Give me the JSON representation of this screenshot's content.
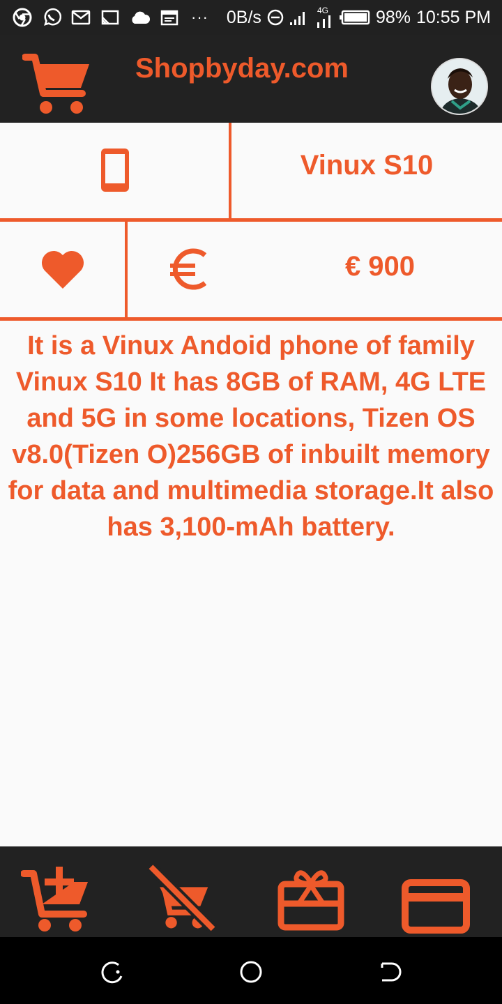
{
  "status_bar": {
    "network_speed": "0B/s",
    "network_type": "4G",
    "battery": "98%",
    "time": "10:55 PM",
    "overflow": "···",
    "icons": [
      "chrome-icon",
      "whatsapp-icon",
      "gmail-icon",
      "cast-icon",
      "cloud-icon",
      "calendar-icon",
      "dnd-icon",
      "signal-icon",
      "battery-icon"
    ]
  },
  "app_bar": {
    "title": "Shopbyday.com",
    "logo_icon": "shopping-cart-icon",
    "avatar": "user-avatar"
  },
  "product": {
    "category_icon": "smartphone-icon",
    "name": "Vinux S10",
    "favorite_icon": "heart-icon",
    "currency_icon": "euro-icon",
    "price": "€ 900",
    "description": "It is a Vinux Andoid phone of family Vinux S10 It has 8GB of RAM, 4G LTE and 5G in some locations, Tizen OS v8.0(Tizen O)256GB of inbuilt memory for data and multimedia storage.It also has 3,100-mAh battery."
  },
  "bottom_bar": {
    "items": [
      {
        "icon": "add-to-cart-icon"
      },
      {
        "icon": "remove-from-cart-icon"
      },
      {
        "icon": "gift-card-icon"
      },
      {
        "icon": "credit-card-icon"
      }
    ]
  },
  "nav_bar": {
    "buttons": [
      "recent-apps",
      "home",
      "back"
    ]
  },
  "colors": {
    "accent": "#ee5a2b",
    "bar_background": "#222222",
    "page_background": "#fafafa"
  }
}
